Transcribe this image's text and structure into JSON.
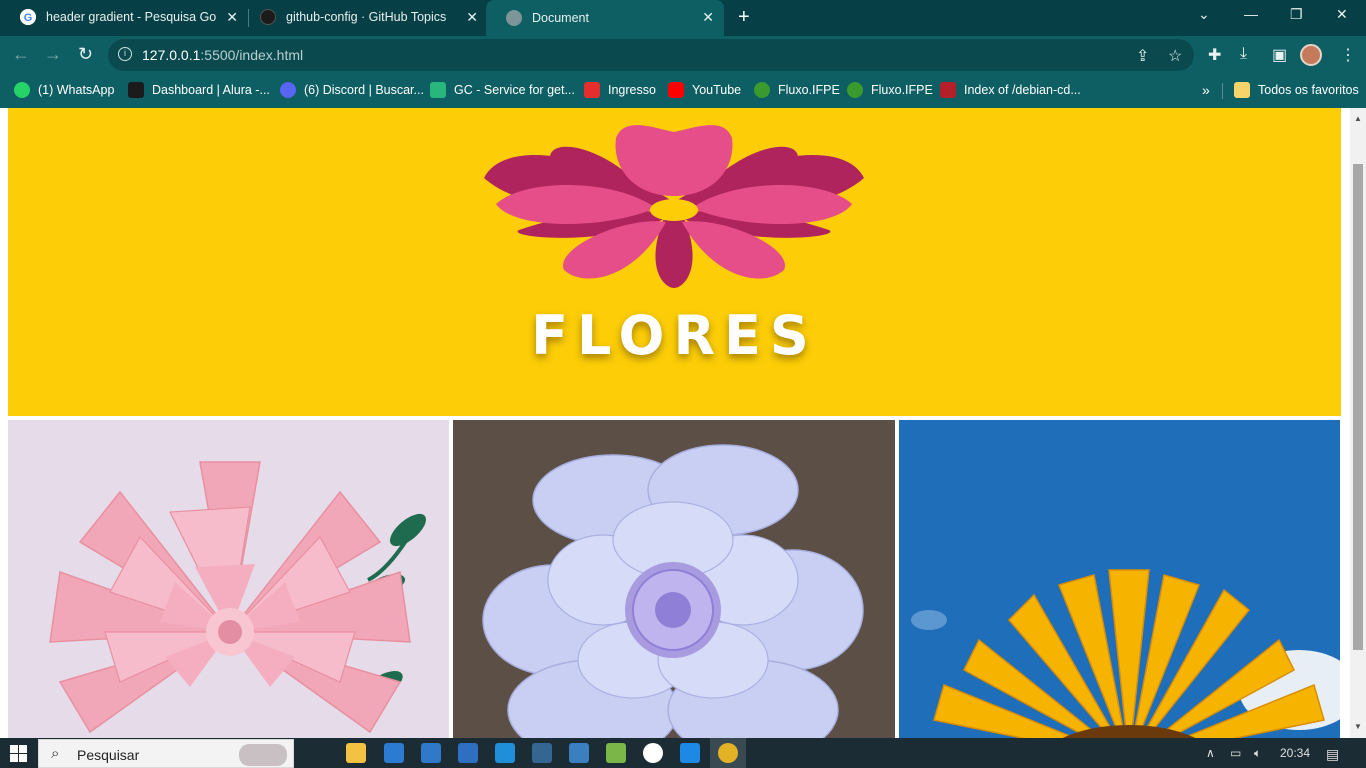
{
  "browser": {
    "tabs": [
      {
        "title": "header gradient - Pesquisa Google",
        "favicon": "google-icon",
        "active": false
      },
      {
        "title": "github-config · GitHub Topics",
        "favicon": "github-icon",
        "active": false
      },
      {
        "title": "Document",
        "favicon": "globe-icon",
        "active": true
      }
    ],
    "url_host": "127.0.0.1",
    "url_rest": ":5500/index.html",
    "bookmarks": [
      {
        "label": "(1) WhatsApp",
        "icon": "whatsapp-icon",
        "color": "#25d366"
      },
      {
        "label": "Dashboard | Alura -...",
        "icon": "alura-icon",
        "color": "#1a1a1a"
      },
      {
        "label": "(6) Discord | Buscar...",
        "icon": "discord-icon",
        "color": "#5865f2"
      },
      {
        "label": "GC - Service for get...",
        "icon": "stack-icon",
        "color": "#29b67a"
      },
      {
        "label": "Ingresso",
        "icon": "check-icon",
        "color": "#e62d2d"
      },
      {
        "label": "YouTube",
        "icon": "youtube-icon",
        "color": "#ff0000"
      },
      {
        "label": "Fluxo.IFPE",
        "icon": "fluxo-icon",
        "color": "#3a9a2e"
      },
      {
        "label": "Fluxo.IFPE",
        "icon": "fluxo-icon",
        "color": "#3a9a2e"
      },
      {
        "label": "Index of /debian-cd...",
        "icon": "apache-icon",
        "color": "#b3202a"
      }
    ],
    "all_bookmarks": "Todos os favoritos"
  },
  "page": {
    "hero_title": "FLORES",
    "hero_bg": "#fdce07"
  },
  "taskbar": {
    "search_label": "Pesquisar",
    "time": "20:34"
  }
}
